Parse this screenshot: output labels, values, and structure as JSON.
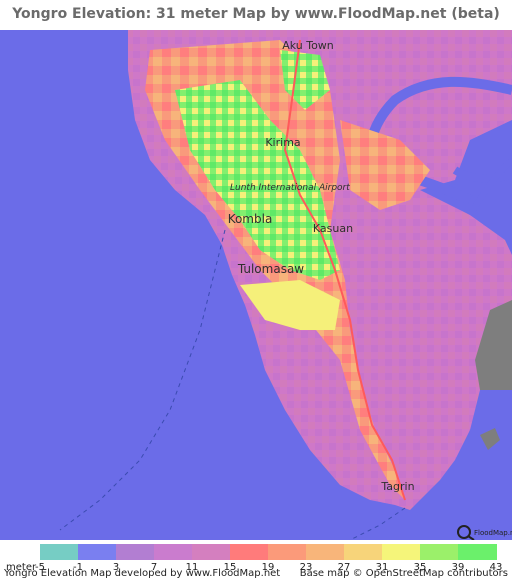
{
  "title": "Yongro Elevation: 31 meter Map by www.FloodMap.net (beta)",
  "map": {
    "places": [
      {
        "name": "Aku Town"
      },
      {
        "name": "Kirima"
      },
      {
        "name": "Lunth International Airport"
      },
      {
        "name": "Kombla"
      },
      {
        "name": "Kasuan"
      },
      {
        "name": "Tulomasaw"
      },
      {
        "name": "Tagrin"
      }
    ],
    "watermark": "FloodMap.net",
    "colors": {
      "sea": "#6b6ce8",
      "low": "#c07ad0",
      "mid": "#ff8c7a",
      "high": "#7cf07a"
    }
  },
  "legend": {
    "unit": "meter",
    "ticks": [
      "-5",
      "-1",
      "3",
      "7",
      "11",
      "15",
      "19",
      "23",
      "27",
      "31",
      "35",
      "39",
      "43"
    ],
    "colors": [
      "#76cdc4",
      "#7a7ff0",
      "#b27ed2",
      "#ca7cce",
      "#d47fbf",
      "#ff7b7b",
      "#fb9a7a",
      "#f8b57a",
      "#f7d47a",
      "#f5f57a",
      "#9bf06a",
      "#6bf06b"
    ]
  },
  "footer": {
    "left": "Yongro Elevation Map developed by www.FloodMap.net",
    "right": "Base map © OpenStreetMap contributors"
  }
}
